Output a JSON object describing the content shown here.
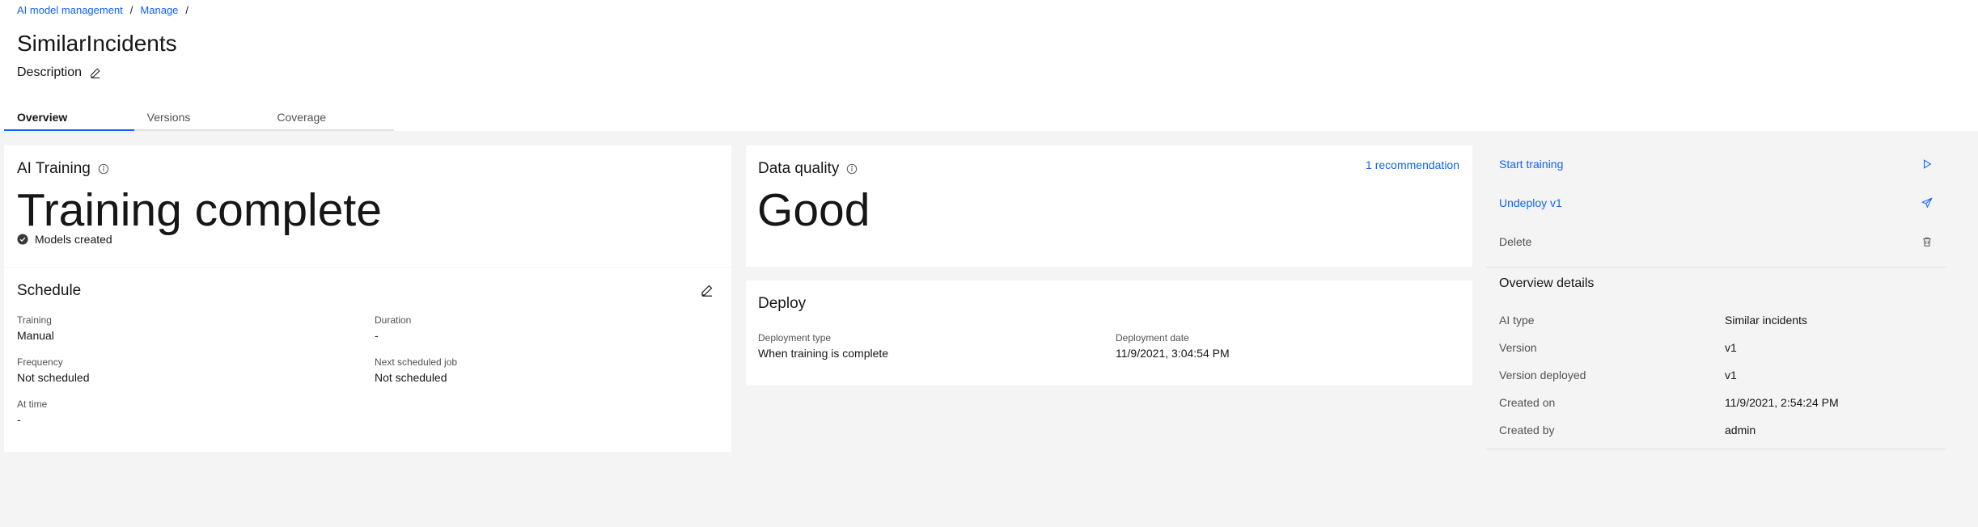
{
  "breadcrumb": {
    "items": [
      "AI model management",
      "Manage"
    ],
    "sep": "/"
  },
  "page": {
    "title": "SimilarIncidents",
    "description": "Description"
  },
  "tabs": [
    {
      "label": "Overview",
      "active": true
    },
    {
      "label": "Versions",
      "active": false
    },
    {
      "label": "Coverage",
      "active": false
    }
  ],
  "ai_training": {
    "title": "AI Training",
    "status": "Training complete",
    "sub_status": "Models created"
  },
  "schedule": {
    "title": "Schedule",
    "fields": [
      {
        "label": "Training",
        "value": "Manual"
      },
      {
        "label": "Duration",
        "value": "-"
      },
      {
        "label": "Frequency",
        "value": "Not scheduled"
      },
      {
        "label": "Next scheduled job",
        "value": "Not scheduled"
      },
      {
        "label": "At time",
        "value": "-"
      }
    ]
  },
  "data_quality": {
    "title": "Data quality",
    "value": "Good",
    "recommendation_link": "1 recommendation"
  },
  "deploy": {
    "title": "Deploy",
    "fields": [
      {
        "label": "Deployment type",
        "value": "When training is complete"
      },
      {
        "label": "Deployment date",
        "value": "11/9/2021, 3:04:54 PM"
      }
    ]
  },
  "actions": [
    {
      "label": "Start training",
      "icon": "play-icon",
      "style": "link"
    },
    {
      "label": "Undeploy v1",
      "icon": "send-icon",
      "style": "link"
    },
    {
      "label": "Delete",
      "icon": "trash-icon",
      "style": "muted"
    }
  ],
  "overview_details": {
    "title": "Overview details",
    "rows": [
      {
        "label": "AI type",
        "value": "Similar incidents"
      },
      {
        "label": "Version",
        "value": "v1"
      },
      {
        "label": "Version deployed",
        "value": "v1"
      },
      {
        "label": "Created on",
        "value": "11/9/2021, 2:54:24 PM"
      },
      {
        "label": "Created by",
        "value": "admin"
      }
    ]
  },
  "colors": {
    "accent": "#0f62fe",
    "background": "#f4f4f4",
    "card": "#ffffff",
    "text": "#161616",
    "muted": "#525252"
  }
}
